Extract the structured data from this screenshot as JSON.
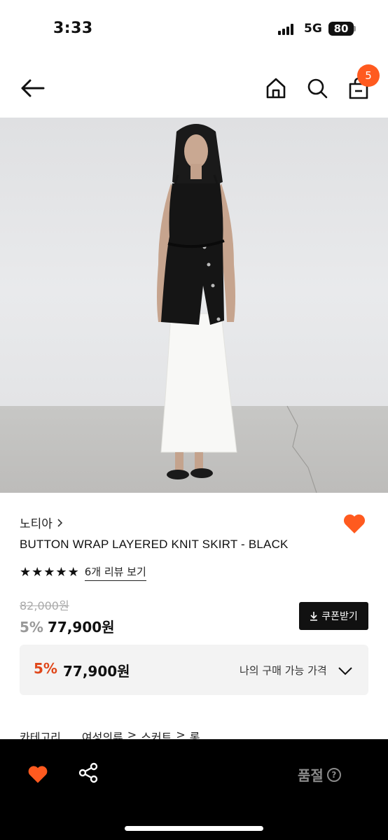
{
  "status_bar": {
    "time": "3:33",
    "network": "5G",
    "battery": "80"
  },
  "header": {
    "cart_count": "5"
  },
  "product": {
    "brand": "노티아",
    "name": "BUTTON WRAP LAYERED KNIT SKIRT - BLACK",
    "rating_stars": 5,
    "review_link": "6개 리뷰 보기",
    "original_price": "82,000원",
    "discount": "5%",
    "price": "77,900원",
    "coupon_button": "쿠폰받기"
  },
  "best_price": {
    "discount": "5%",
    "price": "77,900원",
    "label": "나의 구매 가능 가격"
  },
  "category": {
    "label": "카테고리",
    "path": [
      "여성의류",
      ">",
      "스커트",
      ">",
      "롱"
    ]
  },
  "bottom_bar": {
    "sold_out": "품절",
    "help_icon": "?"
  },
  "colors": {
    "accent": "#ff5a1f",
    "discount_red": "#e0471a",
    "bottom_bar": "#000000"
  },
  "icons": [
    "back-arrow-icon",
    "home-icon",
    "search-icon",
    "shopping-bag-icon",
    "heart-icon",
    "star-icon",
    "download-icon",
    "chevron-down-icon",
    "share-icon",
    "help-icon"
  ]
}
